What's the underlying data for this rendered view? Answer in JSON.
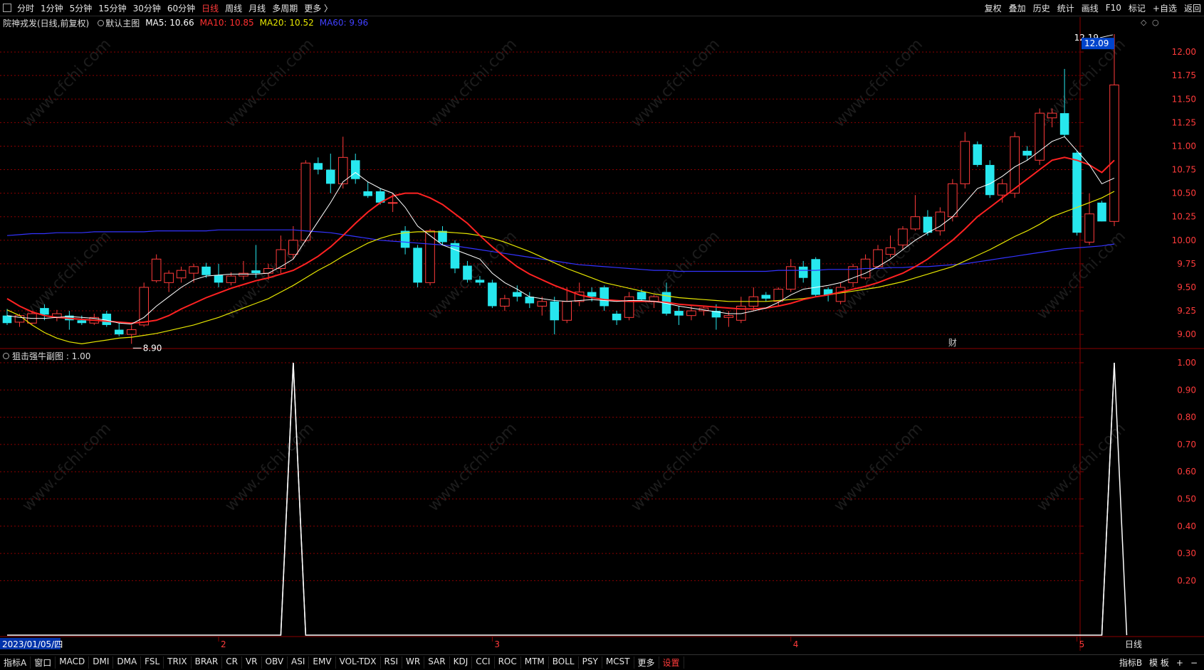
{
  "toolbar": {
    "periods": [
      "分时",
      "1分钟",
      "5分钟",
      "15分钟",
      "30分钟",
      "60分钟",
      "日线",
      "周线",
      "月线",
      "多周期",
      "更多 〉"
    ],
    "active_period": "日线",
    "right_items": [
      "复权",
      "叠加",
      "历史",
      "统计",
      "画线",
      "F10",
      "标记",
      "+自选",
      "返回"
    ]
  },
  "main_chart": {
    "stock_title": "院神戎发(日线,前复权)",
    "template": "默认主图",
    "ma5_label": "MA5: 10.66",
    "ma10_label": "MA10: 10.85",
    "ma20_label": "MA20: 10.52",
    "ma60_label": "MA60: 9.96",
    "current_price_tag": "12.09",
    "high_label": "12.19",
    "low_label": "8.90",
    "event_marker": "财",
    "colors": {
      "up": "#ff3b3b",
      "down": "#27e7ee",
      "ma5": "#ffffff",
      "ma10": "#ff2222",
      "ma20": "#e6e600",
      "ma60": "#3333ff",
      "grid": "#8b0000"
    }
  },
  "sub_chart": {
    "title": "狙击强牛副图 : 1.00",
    "line_color": "#ffffff"
  },
  "x_axis": {
    "start_date": "2023/01/05/四",
    "months": [
      "2",
      "3",
      "4",
      "5"
    ],
    "period_label": "日线"
  },
  "watermark": "www.cfchi.com",
  "bottom_tabs": {
    "items": [
      "指标A",
      "窗口",
      "MACD",
      "DMI",
      "DMA",
      "FSL",
      "TRIX",
      "BRAR",
      "CR",
      "VR",
      "OBV",
      "ASI",
      "EMV",
      "VOL-TDX",
      "RSI",
      "WR",
      "SAR",
      "KDJ",
      "CCI",
      "ROC",
      "MTM",
      "BOLL",
      "PSY",
      "MCST",
      "更多",
      "设置"
    ],
    "active": "设置",
    "right_items": [
      "指标B",
      "模 板",
      "+",
      "−"
    ]
  },
  "chart_data": [
    {
      "type": "candlestick",
      "y_ticks": [
        9.0,
        9.25,
        9.5,
        9.75,
        10.0,
        10.25,
        10.5,
        10.75,
        11.0,
        11.25,
        11.5,
        11.75,
        12.0
      ],
      "ylim": [
        8.85,
        12.25
      ],
      "candles": [
        {
          "o": 9.2,
          "h": 9.27,
          "l": 9.1,
          "c": 9.12
        },
        {
          "o": 9.13,
          "h": 9.22,
          "l": 9.08,
          "c": 9.2
        },
        {
          "o": 9.12,
          "h": 9.25,
          "l": 9.1,
          "c": 9.22
        },
        {
          "o": 9.28,
          "h": 9.32,
          "l": 9.15,
          "c": 9.21
        },
        {
          "o": 9.18,
          "h": 9.26,
          "l": 9.14,
          "c": 9.22
        },
        {
          "o": 9.2,
          "h": 9.25,
          "l": 9.05,
          "c": 9.15
        },
        {
          "o": 9.15,
          "h": 9.2,
          "l": 9.1,
          "c": 9.12
        },
        {
          "o": 9.12,
          "h": 9.22,
          "l": 9.1,
          "c": 9.18
        },
        {
          "o": 9.22,
          "h": 9.25,
          "l": 9.08,
          "c": 9.1
        },
        {
          "o": 9.05,
          "h": 9.12,
          "l": 8.98,
          "c": 9.0
        },
        {
          "o": 9.0,
          "h": 9.1,
          "l": 8.9,
          "c": 9.05
        },
        {
          "o": 9.1,
          "h": 9.55,
          "l": 9.08,
          "c": 9.5
        },
        {
          "o": 9.57,
          "h": 9.85,
          "l": 9.55,
          "c": 9.8
        },
        {
          "o": 9.55,
          "h": 9.68,
          "l": 9.45,
          "c": 9.65
        },
        {
          "o": 9.6,
          "h": 9.72,
          "l": 9.55,
          "c": 9.68
        },
        {
          "o": 9.65,
          "h": 9.75,
          "l": 9.55,
          "c": 9.72
        },
        {
          "o": 9.72,
          "h": 9.76,
          "l": 9.6,
          "c": 9.63
        },
        {
          "o": 9.63,
          "h": 9.75,
          "l": 9.5,
          "c": 9.55
        },
        {
          "o": 9.55,
          "h": 9.66,
          "l": 9.52,
          "c": 9.62
        },
        {
          "o": 9.62,
          "h": 9.78,
          "l": 9.58,
          "c": 9.65
        },
        {
          "o": 9.68,
          "h": 9.95,
          "l": 9.6,
          "c": 9.65
        },
        {
          "o": 9.65,
          "h": 9.75,
          "l": 9.58,
          "c": 9.7
        },
        {
          "o": 9.7,
          "h": 10.05,
          "l": 9.65,
          "c": 9.9
        },
        {
          "o": 9.85,
          "h": 10.15,
          "l": 9.8,
          "c": 10.0
        },
        {
          "o": 10.0,
          "h": 10.85,
          "l": 9.98,
          "c": 10.82
        },
        {
          "o": 10.82,
          "h": 10.88,
          "l": 10.7,
          "c": 10.75
        },
        {
          "o": 10.75,
          "h": 10.92,
          "l": 10.5,
          "c": 10.6
        },
        {
          "o": 10.6,
          "h": 11.1,
          "l": 10.55,
          "c": 10.88
        },
        {
          "o": 10.85,
          "h": 10.92,
          "l": 10.6,
          "c": 10.65
        },
        {
          "o": 10.52,
          "h": 10.62,
          "l": 10.45,
          "c": 10.47
        },
        {
          "o": 10.52,
          "h": 10.55,
          "l": 10.38,
          "c": 10.4
        },
        {
          "o": 10.4,
          "h": 10.5,
          "l": 10.3,
          "c": 10.4
        },
        {
          "o": 10.1,
          "h": 10.15,
          "l": 9.85,
          "c": 9.92
        },
        {
          "o": 9.92,
          "h": 9.95,
          "l": 9.5,
          "c": 9.55
        },
        {
          "o": 9.55,
          "h": 10.12,
          "l": 9.52,
          "c": 10.1
        },
        {
          "o": 10.1,
          "h": 10.15,
          "l": 9.95,
          "c": 9.98
        },
        {
          "o": 9.97,
          "h": 10.0,
          "l": 9.65,
          "c": 9.7
        },
        {
          "o": 9.73,
          "h": 9.78,
          "l": 9.55,
          "c": 9.58
        },
        {
          "o": 9.58,
          "h": 9.62,
          "l": 9.52,
          "c": 9.55
        },
        {
          "o": 9.55,
          "h": 9.58,
          "l": 9.28,
          "c": 9.3
        },
        {
          "o": 9.3,
          "h": 9.42,
          "l": 9.25,
          "c": 9.38
        },
        {
          "o": 9.45,
          "h": 9.52,
          "l": 9.35,
          "c": 9.4
        },
        {
          "o": 9.4,
          "h": 9.45,
          "l": 9.28,
          "c": 9.33
        },
        {
          "o": 9.3,
          "h": 9.4,
          "l": 9.2,
          "c": 9.35
        },
        {
          "o": 9.35,
          "h": 9.4,
          "l": 9.0,
          "c": 9.15
        },
        {
          "o": 9.15,
          "h": 9.5,
          "l": 9.12,
          "c": 9.35
        },
        {
          "o": 9.35,
          "h": 9.55,
          "l": 9.3,
          "c": 9.45
        },
        {
          "o": 9.45,
          "h": 9.5,
          "l": 9.35,
          "c": 9.4
        },
        {
          "o": 9.5,
          "h": 9.52,
          "l": 9.25,
          "c": 9.3
        },
        {
          "o": 9.22,
          "h": 9.25,
          "l": 9.1,
          "c": 9.15
        },
        {
          "o": 9.18,
          "h": 9.45,
          "l": 9.15,
          "c": 9.4
        },
        {
          "o": 9.45,
          "h": 9.48,
          "l": 9.35,
          "c": 9.37
        },
        {
          "o": 9.35,
          "h": 9.42,
          "l": 9.28,
          "c": 9.4
        },
        {
          "o": 9.45,
          "h": 9.55,
          "l": 9.2,
          "c": 9.22
        },
        {
          "o": 9.25,
          "h": 9.3,
          "l": 9.1,
          "c": 9.2
        },
        {
          "o": 9.2,
          "h": 9.3,
          "l": 9.15,
          "c": 9.25
        },
        {
          "o": 9.25,
          "h": 9.3,
          "l": 9.2,
          "c": 9.28
        },
        {
          "o": 9.25,
          "h": 9.32,
          "l": 9.05,
          "c": 9.18
        },
        {
          "o": 9.18,
          "h": 9.25,
          "l": 9.08,
          "c": 9.2
        },
        {
          "o": 9.15,
          "h": 9.4,
          "l": 9.12,
          "c": 9.3
        },
        {
          "o": 9.3,
          "h": 9.5,
          "l": 9.25,
          "c": 9.4
        },
        {
          "o": 9.42,
          "h": 9.45,
          "l": 9.35,
          "c": 9.38
        },
        {
          "o": 9.35,
          "h": 9.5,
          "l": 9.3,
          "c": 9.48
        },
        {
          "o": 9.48,
          "h": 9.8,
          "l": 9.45,
          "c": 9.72
        },
        {
          "o": 9.72,
          "h": 9.78,
          "l": 9.55,
          "c": 9.6
        },
        {
          "o": 9.8,
          "h": 9.82,
          "l": 9.4,
          "c": 9.42
        },
        {
          "o": 9.48,
          "h": 9.5,
          "l": 9.35,
          "c": 9.42
        },
        {
          "o": 9.35,
          "h": 9.55,
          "l": 9.32,
          "c": 9.5
        },
        {
          "o": 9.55,
          "h": 9.75,
          "l": 9.5,
          "c": 9.72
        },
        {
          "o": 9.6,
          "h": 9.85,
          "l": 9.58,
          "c": 9.8
        },
        {
          "o": 9.72,
          "h": 9.95,
          "l": 9.7,
          "c": 9.9
        },
        {
          "o": 9.85,
          "h": 10.05,
          "l": 9.82,
          "c": 9.92
        },
        {
          "o": 9.95,
          "h": 10.15,
          "l": 9.9,
          "c": 10.12
        },
        {
          "o": 10.12,
          "h": 10.48,
          "l": 10.1,
          "c": 10.25
        },
        {
          "o": 10.25,
          "h": 10.32,
          "l": 10.05,
          "c": 10.08
        },
        {
          "o": 10.1,
          "h": 10.35,
          "l": 10.05,
          "c": 10.3
        },
        {
          "o": 10.25,
          "h": 10.65,
          "l": 10.2,
          "c": 10.6
        },
        {
          "o": 10.6,
          "h": 11.15,
          "l": 10.55,
          "c": 11.05
        },
        {
          "o": 11.02,
          "h": 11.05,
          "l": 10.78,
          "c": 10.8
        },
        {
          "o": 10.8,
          "h": 10.85,
          "l": 10.45,
          "c": 10.48
        },
        {
          "o": 10.48,
          "h": 10.65,
          "l": 10.4,
          "c": 10.6
        },
        {
          "o": 10.5,
          "h": 11.15,
          "l": 10.45,
          "c": 11.1
        },
        {
          "o": 10.95,
          "h": 11.0,
          "l": 10.85,
          "c": 10.9
        },
        {
          "o": 10.85,
          "h": 11.4,
          "l": 10.8,
          "c": 11.35
        },
        {
          "o": 11.3,
          "h": 11.4,
          "l": 11.2,
          "c": 11.35
        },
        {
          "o": 11.35,
          "h": 11.82,
          "l": 11.1,
          "c": 11.12
        },
        {
          "o": 10.93,
          "h": 10.95,
          "l": 10.05,
          "c": 10.08
        },
        {
          "o": 9.98,
          "h": 10.5,
          "l": 9.95,
          "c": 10.28
        },
        {
          "o": 10.4,
          "h": 10.42,
          "l": 10.2,
          "c": 10.2
        },
        {
          "o": 10.2,
          "h": 12.19,
          "l": 10.15,
          "c": 11.65
        }
      ],
      "ma5": [
        9.2,
        9.18,
        9.17,
        9.17,
        9.18,
        9.19,
        9.18,
        9.17,
        9.15,
        9.12,
        9.11,
        9.18,
        9.3,
        9.4,
        9.5,
        9.58,
        9.62,
        9.63,
        9.64,
        9.64,
        9.64,
        9.65,
        9.72,
        9.8,
        10.0,
        10.2,
        10.4,
        10.62,
        10.72,
        10.62,
        10.55,
        10.5,
        10.35,
        10.15,
        10.05,
        9.95,
        9.9,
        9.85,
        9.8,
        9.65,
        9.55,
        9.48,
        9.4,
        9.38,
        9.36,
        9.35,
        9.36,
        9.37,
        9.36,
        9.35,
        9.36,
        9.36,
        9.35,
        9.33,
        9.3,
        9.28,
        9.26,
        9.24,
        9.22,
        9.22,
        9.25,
        9.28,
        9.34,
        9.42,
        9.48,
        9.5,
        9.52,
        9.55,
        9.6,
        9.65,
        9.72,
        9.8,
        9.9,
        10.0,
        10.08,
        10.15,
        10.25,
        10.4,
        10.55,
        10.6,
        10.68,
        10.78,
        10.85,
        10.95,
        11.05,
        11.1,
        10.95,
        10.8,
        10.6,
        10.66
      ],
      "ma10": [
        9.38,
        9.3,
        9.24,
        9.2,
        9.18,
        9.17,
        9.16,
        9.15,
        9.14,
        9.13,
        9.12,
        9.13,
        9.15,
        9.2,
        9.27,
        9.33,
        9.39,
        9.44,
        9.49,
        9.53,
        9.57,
        9.6,
        9.64,
        9.68,
        9.75,
        9.83,
        9.93,
        10.05,
        10.18,
        10.3,
        10.4,
        10.47,
        10.5,
        10.5,
        10.45,
        10.38,
        10.28,
        10.18,
        10.05,
        9.93,
        9.82,
        9.72,
        9.64,
        9.58,
        9.52,
        9.47,
        9.42,
        9.39,
        9.37,
        9.36,
        9.35,
        9.35,
        9.35,
        9.34,
        9.32,
        9.31,
        9.3,
        9.29,
        9.28,
        9.27,
        9.27,
        9.28,
        9.3,
        9.33,
        9.37,
        9.4,
        9.42,
        9.45,
        9.48,
        9.51,
        9.55,
        9.6,
        9.65,
        9.72,
        9.8,
        9.9,
        10.0,
        10.12,
        10.25,
        10.35,
        10.45,
        10.55,
        10.65,
        10.75,
        10.85,
        10.88,
        10.85,
        10.8,
        10.72,
        10.85
      ],
      "ma20": [
        9.26,
        9.2,
        9.1,
        9.02,
        8.96,
        8.92,
        8.9,
        8.92,
        8.94,
        8.96,
        8.97,
        8.99,
        9.01,
        9.04,
        9.07,
        9.1,
        9.14,
        9.18,
        9.23,
        9.28,
        9.33,
        9.38,
        9.45,
        9.52,
        9.6,
        9.68,
        9.75,
        9.83,
        9.9,
        9.97,
        10.02,
        10.06,
        10.08,
        10.09,
        10.09,
        10.09,
        10.08,
        10.07,
        10.05,
        10.02,
        9.98,
        9.93,
        9.88,
        9.82,
        9.76,
        9.7,
        9.65,
        9.6,
        9.55,
        9.52,
        9.49,
        9.46,
        9.43,
        9.41,
        9.39,
        9.38,
        9.37,
        9.36,
        9.35,
        9.35,
        9.35,
        9.35,
        9.36,
        9.37,
        9.38,
        9.4,
        9.42,
        9.44,
        9.46,
        9.48,
        9.5,
        9.53,
        9.56,
        9.6,
        9.64,
        9.68,
        9.72,
        9.78,
        9.84,
        9.9,
        9.97,
        10.04,
        10.1,
        10.17,
        10.25,
        10.3,
        10.35,
        10.4,
        10.45,
        10.52
      ],
      "ma60": [
        10.05,
        10.06,
        10.07,
        10.07,
        10.08,
        10.08,
        10.08,
        10.09,
        10.09,
        10.09,
        10.09,
        10.09,
        10.1,
        10.1,
        10.1,
        10.1,
        10.1,
        10.11,
        10.11,
        10.11,
        10.11,
        10.11,
        10.11,
        10.11,
        10.1,
        10.09,
        10.08,
        10.06,
        10.04,
        10.02,
        10.0,
        9.99,
        9.98,
        9.97,
        9.96,
        9.95,
        9.94,
        9.92,
        9.9,
        9.88,
        9.86,
        9.84,
        9.82,
        9.8,
        9.78,
        9.76,
        9.74,
        9.73,
        9.72,
        9.71,
        9.7,
        9.69,
        9.68,
        9.68,
        9.67,
        9.67,
        9.67,
        9.67,
        9.67,
        9.67,
        9.67,
        9.67,
        9.68,
        9.68,
        9.68,
        9.68,
        9.69,
        9.69,
        9.69,
        9.7,
        9.7,
        9.71,
        9.71,
        9.72,
        9.72,
        9.73,
        9.74,
        9.75,
        9.77,
        9.79,
        9.81,
        9.83,
        9.85,
        9.87,
        9.89,
        9.91,
        9.92,
        9.93,
        9.94,
        9.96
      ]
    },
    {
      "type": "line",
      "y_ticks": [
        0.2,
        0.3,
        0.4,
        0.5,
        0.6,
        0.7,
        0.8,
        0.9,
        1.0
      ],
      "ylim": [
        0.0,
        1.0
      ],
      "values": [
        0,
        0,
        0,
        0,
        0,
        0,
        0,
        0,
        0,
        0,
        0,
        0,
        0,
        0,
        0,
        0,
        0,
        0,
        0,
        0,
        0,
        0,
        0,
        1,
        0,
        0,
        0,
        0,
        0,
        0,
        0,
        0,
        0,
        0,
        0,
        0,
        0,
        0,
        0,
        0,
        0,
        0,
        0,
        0,
        0,
        0,
        0,
        0,
        0,
        0,
        0,
        0,
        0,
        0,
        0,
        0,
        0,
        0,
        0,
        0,
        0,
        0,
        0,
        0,
        0,
        0,
        0,
        0,
        0,
        0,
        0,
        0,
        0,
        0,
        0,
        0,
        0,
        0,
        0,
        0,
        0,
        0,
        0,
        0,
        0,
        0,
        0,
        0,
        0,
        1
      ]
    }
  ]
}
